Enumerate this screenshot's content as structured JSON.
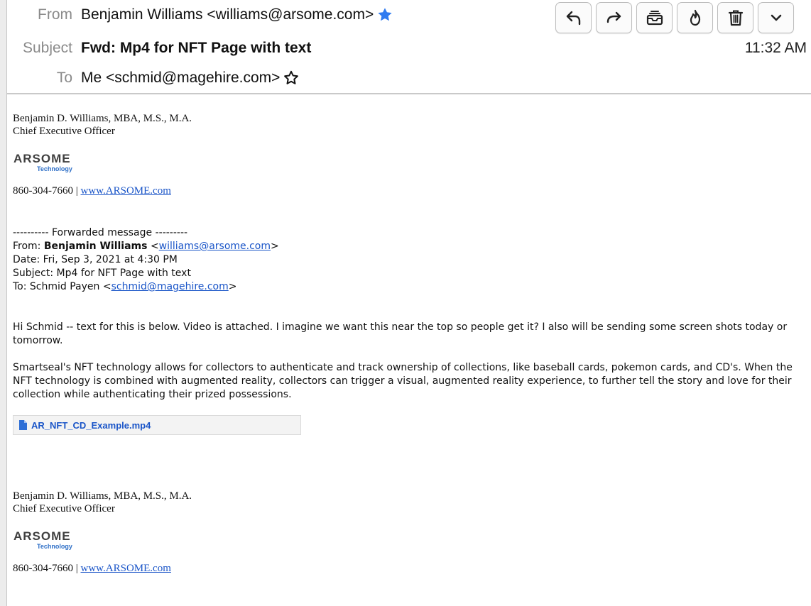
{
  "header": {
    "from_label": "From",
    "from_value": "Benjamin Williams <williams@arsome.com>",
    "subject_label": "Subject",
    "subject_value": "Fwd: Mp4 for NFT Page with text",
    "to_label": "To",
    "to_value": "Me <schmid@magehire.com>",
    "time": "11:32 AM",
    "from_starred": true,
    "to_starred": false
  },
  "toolbar": {
    "buttons": [
      "reply-icon",
      "forward-icon",
      "archive-icon",
      "flame-junk-icon",
      "trash-icon",
      "chevron-down-icon"
    ]
  },
  "signature": {
    "name": "Benjamin D. Williams, MBA, M.S., M.A.",
    "title": "Chief Executive Officer",
    "logo_main": "ARSOME",
    "logo_sub": "Technology",
    "phone": "860-304-7660",
    "separator": "|",
    "website": "www.ARSOME.com"
  },
  "forwarded": {
    "divider": "---------- Forwarded message ---------",
    "from_label": "From:",
    "from_name": "Benjamin Williams",
    "from_email": "williams@arsome.com",
    "date_line": "Date: Fri, Sep 3, 2021 at 4:30 PM",
    "subject_line": "Subject: Mp4 for NFT Page with text",
    "to_label": "To: Schmid Payen",
    "to_email": "schmid@magehire.com"
  },
  "body": {
    "paragraph1": "Hi Schmid -- text for this is below. Video is attached. I imagine we want this near the top so people get it? I also will be sending some screen shots today or tomorrow.",
    "paragraph2": "Smartseal's NFT technology allows for collectors to authenticate and track ownership of collections, like baseball cards, pokemon cards, and CD's. When the NFT technology is combined with augmented reality, collectors can trigger a visual, augmented reality experience, to further tell the story and love for their collection while authenticating their prized possessions."
  },
  "attachment": {
    "name": "AR_NFT_CD_Example.mp4",
    "icon": "file-icon"
  },
  "colors": {
    "link": "#1a55c8",
    "star_filled": "#2f7bf0",
    "label_gray": "#8a8a8a"
  }
}
